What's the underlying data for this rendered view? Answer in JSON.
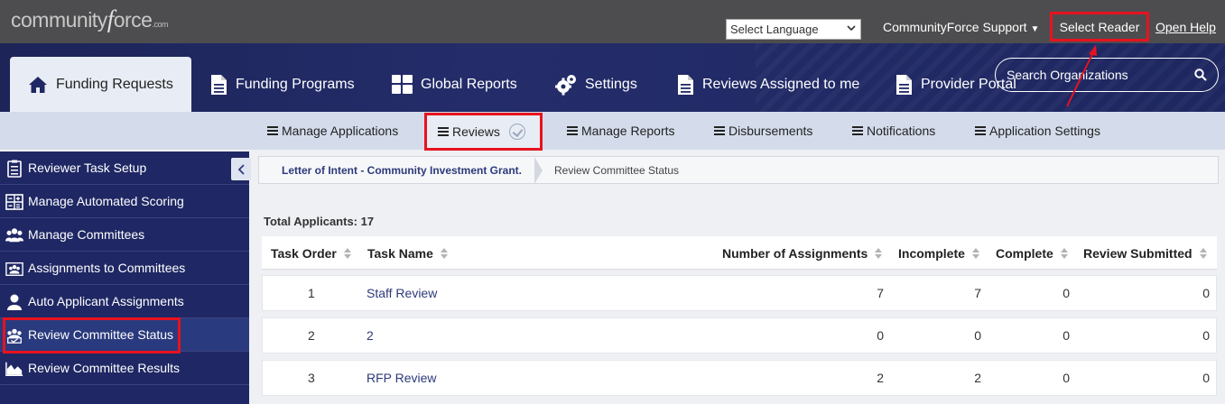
{
  "topbar": {
    "logo_main": "community",
    "logo_f": "f",
    "logo_rest": "orce",
    "logo_com": ".com",
    "language_select": "Select Language",
    "support": "CommunityForce Support",
    "select_reader": "Select Reader",
    "open_help": "Open Help"
  },
  "nav": {
    "items": [
      {
        "label": "Funding Requests",
        "icon": "home-icon"
      },
      {
        "label": "Funding Programs",
        "icon": "document-icon"
      },
      {
        "label": "Global Reports",
        "icon": "grid-icon"
      },
      {
        "label": "Settings",
        "icon": "gears-icon"
      },
      {
        "label": "Reviews Assigned to me",
        "icon": "document-icon"
      },
      {
        "label": "Provider Portal",
        "icon": "document-icon"
      }
    ],
    "search_placeholder": "Search Organizations"
  },
  "subnav": {
    "items": [
      {
        "label": "Manage Applications"
      },
      {
        "label": "Reviews"
      },
      {
        "label": "Manage Reports"
      },
      {
        "label": "Disbursements"
      },
      {
        "label": "Notifications"
      },
      {
        "label": "Application Settings"
      }
    ]
  },
  "sidebar": {
    "items": [
      {
        "label": "Reviewer Task Setup",
        "icon": "clipboard-icon"
      },
      {
        "label": "Manage Automated Scoring",
        "icon": "calculator-icon"
      },
      {
        "label": "Manage Committees",
        "icon": "users-icon"
      },
      {
        "label": "Assignments to Committees",
        "icon": "committee-assign-icon"
      },
      {
        "label": "Auto Applicant Assignments",
        "icon": "user-icon"
      },
      {
        "label": "Review Committee Status",
        "icon": "committee-status-icon"
      },
      {
        "label": "Review Committee Results",
        "icon": "area-chart-icon"
      }
    ]
  },
  "breadcrumb": {
    "first": "Letter of Intent - Community Investment Grant.",
    "second": "Review Committee Status"
  },
  "total_label": "Total Applicants:",
  "total_value": "17",
  "table": {
    "headers": {
      "task_order": "Task Order",
      "task_name": "Task Name",
      "assignments": "Number of Assignments",
      "incomplete": "Incomplete",
      "complete": "Complete",
      "submitted": "Review Submitted"
    },
    "rows": [
      {
        "order": "1",
        "name": "Staff Review",
        "assignments": "7",
        "incomplete": "7",
        "complete": "0",
        "submitted": "0"
      },
      {
        "order": "2",
        "name": "2",
        "assignments": "0",
        "incomplete": "0",
        "complete": "0",
        "submitted": "0"
      },
      {
        "order": "3",
        "name": "RFP Review",
        "assignments": "2",
        "incomplete": "2",
        "complete": "0",
        "submitted": "0"
      }
    ]
  },
  "colors": {
    "nav_bg": "#1f2864",
    "topbar_bg": "#4d4d4f",
    "highlight_red": "#e8121f",
    "link": "#2d3a7a"
  }
}
